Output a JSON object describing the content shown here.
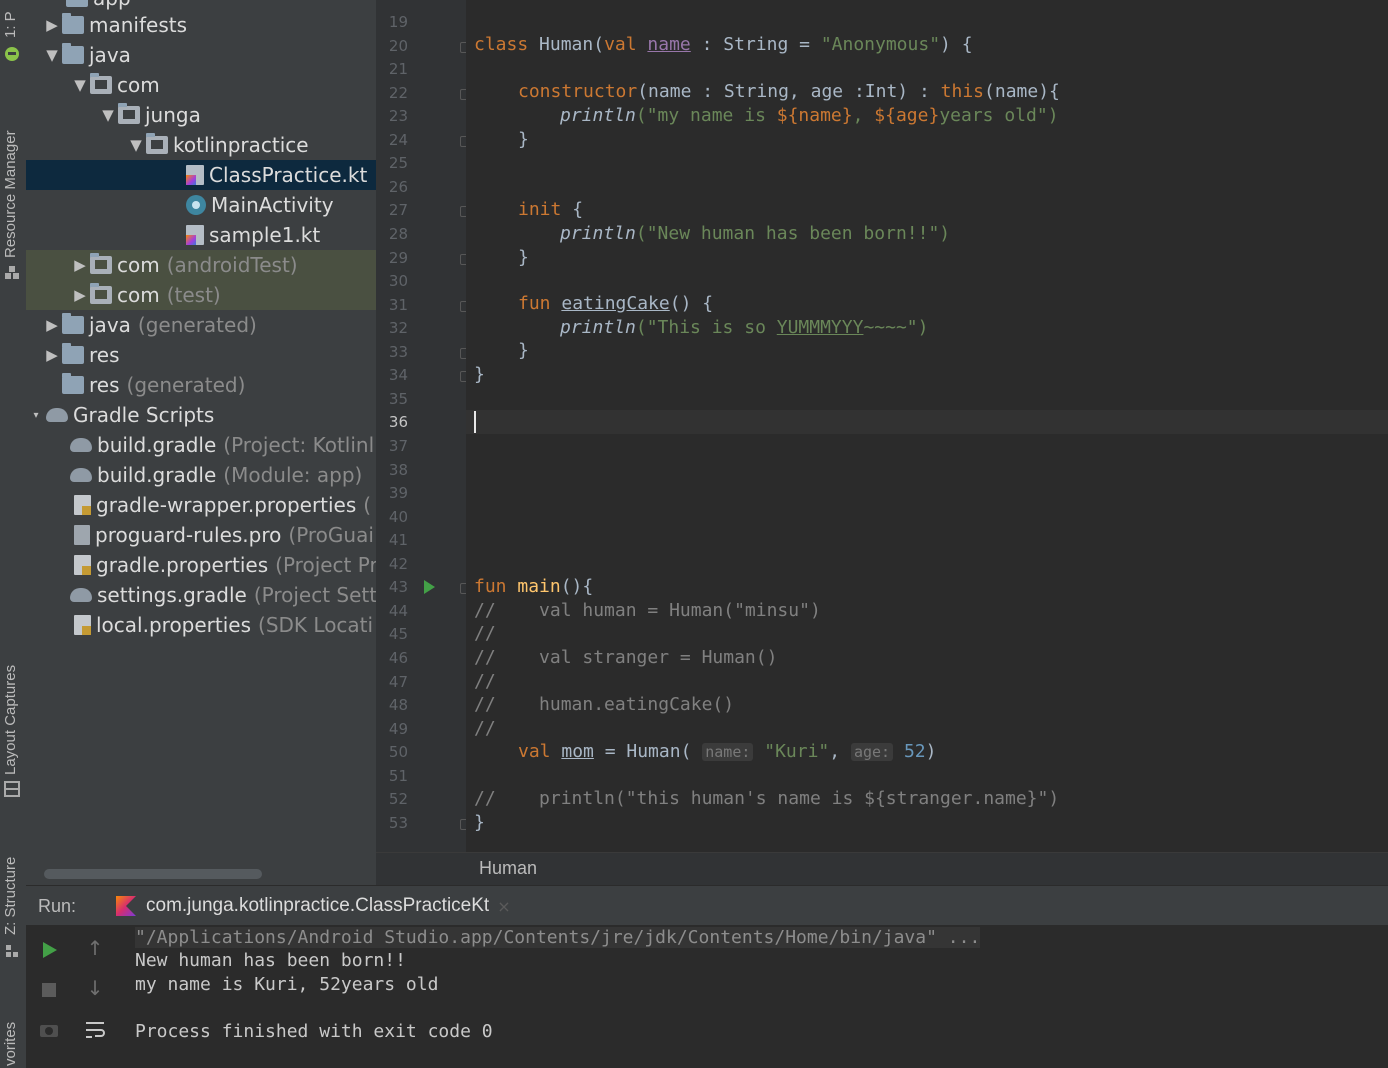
{
  "sidebar": {
    "project_label": "1: P",
    "resource_manager_label": "Resource Manager",
    "layout_captures_label": "Layout Captures",
    "structure_label": "Z: Structure",
    "favorites_label": "vorites"
  },
  "project_tree": {
    "top_partial": "app",
    "items": [
      {
        "text": "manifests",
        "note": ""
      },
      {
        "text": "java",
        "note": ""
      },
      {
        "text": "com",
        "note": ""
      },
      {
        "text": "junga",
        "note": ""
      },
      {
        "text": "kotlinpractice",
        "note": ""
      },
      {
        "text": "ClassPractice.kt",
        "note": ""
      },
      {
        "text": "MainActivity",
        "note": ""
      },
      {
        "text": "sample1.kt",
        "note": ""
      },
      {
        "text": "com",
        "note": "(androidTest)"
      },
      {
        "text": "com",
        "note": "(test)"
      },
      {
        "text": "java",
        "note": "(generated)"
      },
      {
        "text": "res",
        "note": ""
      },
      {
        "text": "res",
        "note": "(generated)"
      },
      {
        "text": "Gradle Scripts",
        "note": ""
      },
      {
        "text": "build.gradle",
        "note": "(Project: Kotlinl"
      },
      {
        "text": "build.gradle",
        "note": "(Module: app)"
      },
      {
        "text": "gradle-wrapper.properties",
        "note": "("
      },
      {
        "text": "proguard-rules.pro",
        "note": "(ProGuai"
      },
      {
        "text": "gradle.properties",
        "note": "(Project Pr"
      },
      {
        "text": "settings.gradle",
        "note": "(Project Setti"
      },
      {
        "text": "local.properties",
        "note": "(SDK Locati"
      }
    ]
  },
  "editor": {
    "line_numbers": [
      "19",
      "20",
      "21",
      "22",
      "23",
      "24",
      "25",
      "26",
      "27",
      "28",
      "29",
      "30",
      "31",
      "32",
      "33",
      "34",
      "35",
      "36",
      "37",
      "38",
      "39",
      "40",
      "41",
      "42",
      "43",
      "44",
      "45",
      "46",
      "47",
      "48",
      "49",
      "50",
      "51",
      "52",
      "53"
    ],
    "current_line": "36",
    "code": {
      "l20": {
        "kw": "class",
        "name": "Human",
        "open": "(",
        "kw2": "val",
        "param": "name",
        "type": " : String = ",
        "default": "\"Anonymous\"",
        "close": ") {"
      },
      "l22": {
        "kw": "constructor",
        "args": "(name : String, age :Int) : ",
        "kw2": "this",
        "rest": "(name){"
      },
      "l23": {
        "fn": "println",
        "s1": "(\"my name is ",
        "t1": "${name}",
        "s2": ", ",
        "t2": "${age}",
        "s3": "years old\")"
      },
      "l24": "}",
      "l27": {
        "kw": "init",
        "rest": " {"
      },
      "l28": {
        "fn": "println",
        "s1": "(\"New human has been born!!\")"
      },
      "l29": "}",
      "l31": {
        "kw": "fun",
        "name": "eatingCake",
        "rest": "() {"
      },
      "l32": {
        "fn": "println",
        "s1": "(\"This is so ",
        "u": "YUMMMYYY",
        "s2": "~~~~\")"
      },
      "l33": "}",
      "l34": "}",
      "l43": {
        "kw": "fun",
        "name": "main",
        "rest": "(){"
      },
      "l44": "//    val human = Human(\"minsu\")",
      "l45": "//",
      "l46": "//    val stranger = Human()",
      "l47": "//",
      "l48": "//    human.eatingCake()",
      "l49": "//",
      "l50": {
        "kw": "val",
        "var": "mom",
        "eq": " = Human( ",
        "hint1": "name:",
        "str": "\"Kuri\"",
        "comma": ", ",
        "hint2": "age:",
        "num": "52",
        "close": ")"
      },
      "l52": "//    println(\"this human's name is ${stranger.name}\")",
      "l53": "}"
    }
  },
  "breadcrumb": "Human",
  "run_panel": {
    "label": "Run:",
    "tab_label": "com.junga.kotlinpractice.ClassPracticeKt",
    "close_glyph": "×",
    "console_lines": [
      "\"/Applications/Android Studio.app/Contents/jre/jdk/Contents/Home/bin/java\" ...",
      "New human has been born!!",
      "my name is Kuri, 52years old",
      "",
      "Process finished with exit code 0"
    ]
  },
  "colors": {
    "keyword": "#cc7832",
    "string": "#6a8759",
    "comment": "#808080",
    "selection": "#0d293e",
    "run_green": "#43a047"
  }
}
